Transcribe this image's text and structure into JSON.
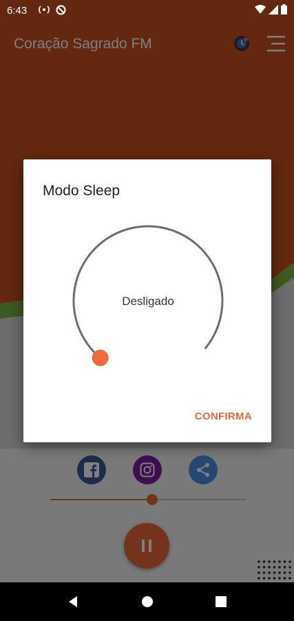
{
  "status_bar": {
    "time": "6:43"
  },
  "app": {
    "title": "Coração Sagrado FM",
    "colors": {
      "brand": "#e8673a",
      "header_bg": "#c6501f",
      "accent_green": "#7cb342"
    }
  },
  "player": {
    "social": [
      {
        "icon": "facebook-icon",
        "color": "#3b5998"
      },
      {
        "icon": "instagram-icon",
        "color": "#7b1fa2"
      },
      {
        "icon": "share-icon",
        "color": "#4a90e2"
      }
    ],
    "volume_fraction": 0.52,
    "play_state": "pause-icon"
  },
  "dialog": {
    "title": "Modo Sleep",
    "dial_value": "Desligado",
    "confirm_label": "CONFIRMA"
  },
  "nav_bar": {
    "items": [
      "back",
      "home",
      "recents"
    ]
  }
}
